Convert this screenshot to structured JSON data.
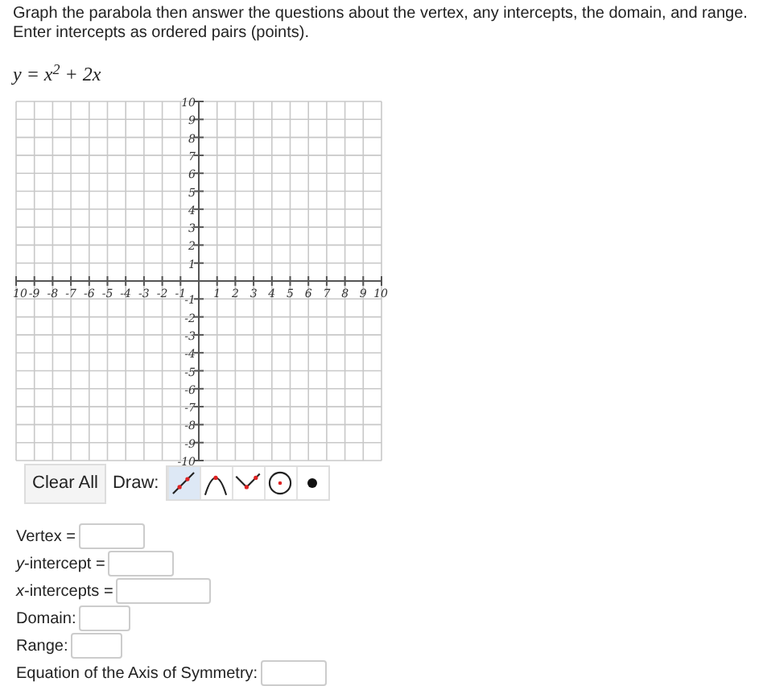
{
  "instructions": [
    "Graph the parabola then answer the questions about the vertex, any intercepts, the domain, and range.",
    "Enter intercepts as ordered pairs (points)."
  ],
  "equation": "y = x$^{2}$ + 2x",
  "graph": {
    "x_labels": [
      "10",
      "-9",
      "-8",
      "-7",
      "-6",
      "-5",
      "-4",
      "-3",
      "-2",
      "-1",
      "1",
      "2",
      "3",
      "4",
      "5",
      "6",
      "7",
      "8",
      "9",
      "10"
    ],
    "y_labels": [
      "10",
      "9",
      "8",
      "7",
      "6",
      "5",
      "4",
      "3",
      "2",
      "1",
      "-1",
      "-2",
      "-3",
      "-4",
      "-5",
      "-6",
      "-7",
      "-8",
      "-9",
      "-10"
    ]
  },
  "clear_button": "Clear All",
  "draw_label": "Draw:",
  "tools": [
    {
      "kind": "line",
      "selected": true
    },
    {
      "kind": "parabola",
      "selected": false
    },
    {
      "kind": "absolute",
      "selected": false
    },
    {
      "kind": "circle",
      "selected": false
    },
    {
      "kind": "point",
      "selected": false
    }
  ],
  "fields": [
    {
      "label": "Vertex ="
    },
    {
      "label": "*y*-intercept ="
    },
    {
      "label": "*x*-intercepts ="
    },
    {
      "label": "Domain:"
    },
    {
      "label": "Range:"
    },
    {
      "label": "Equation of the Axis of Symmetry:"
    }
  ]
}
